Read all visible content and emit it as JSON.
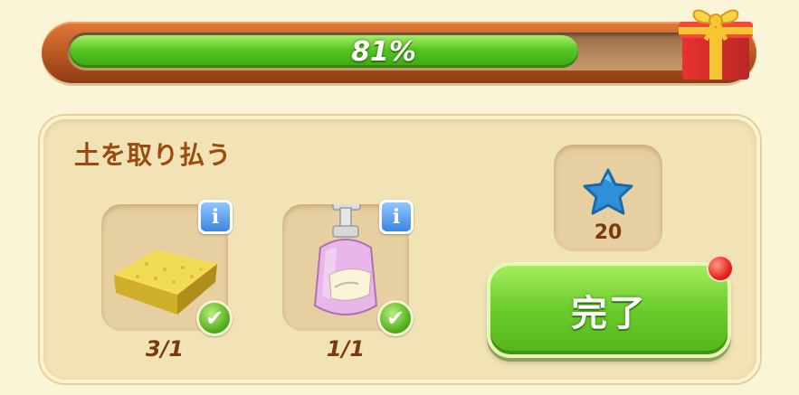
{
  "progress": {
    "value": 0.81,
    "label": "81%"
  },
  "task": {
    "title": "土を取り払う"
  },
  "items": [
    {
      "icon": "sponge-icon",
      "count": "3/1",
      "completed": true
    },
    {
      "icon": "soap-bottle-icon",
      "count": "1/1",
      "completed": true
    }
  ],
  "reward": {
    "icon": "blue-star-icon",
    "amount": "20"
  },
  "complete_button": {
    "label": "完了"
  },
  "info_icon_glyph": "i",
  "check_icon_glyph": "✔",
  "colors": {
    "progress_fill": "#56c522",
    "button": "#6acb2c",
    "title": "#9b4a10"
  }
}
